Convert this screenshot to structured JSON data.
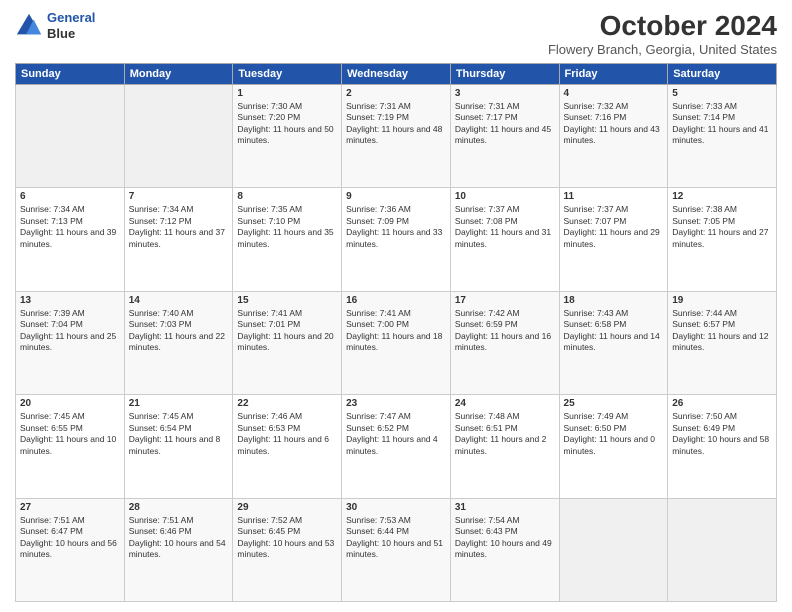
{
  "logo": {
    "line1": "General",
    "line2": "Blue"
  },
  "title": "October 2024",
  "location": "Flowery Branch, Georgia, United States",
  "days_of_week": [
    "Sunday",
    "Monday",
    "Tuesday",
    "Wednesday",
    "Thursday",
    "Friday",
    "Saturday"
  ],
  "weeks": [
    [
      {
        "day": "",
        "sunrise": "",
        "sunset": "",
        "daylight": ""
      },
      {
        "day": "",
        "sunrise": "",
        "sunset": "",
        "daylight": ""
      },
      {
        "day": "1",
        "sunrise": "Sunrise: 7:30 AM",
        "sunset": "Sunset: 7:20 PM",
        "daylight": "Daylight: 11 hours and 50 minutes."
      },
      {
        "day": "2",
        "sunrise": "Sunrise: 7:31 AM",
        "sunset": "Sunset: 7:19 PM",
        "daylight": "Daylight: 11 hours and 48 minutes."
      },
      {
        "day": "3",
        "sunrise": "Sunrise: 7:31 AM",
        "sunset": "Sunset: 7:17 PM",
        "daylight": "Daylight: 11 hours and 45 minutes."
      },
      {
        "day": "4",
        "sunrise": "Sunrise: 7:32 AM",
        "sunset": "Sunset: 7:16 PM",
        "daylight": "Daylight: 11 hours and 43 minutes."
      },
      {
        "day": "5",
        "sunrise": "Sunrise: 7:33 AM",
        "sunset": "Sunset: 7:14 PM",
        "daylight": "Daylight: 11 hours and 41 minutes."
      }
    ],
    [
      {
        "day": "6",
        "sunrise": "Sunrise: 7:34 AM",
        "sunset": "Sunset: 7:13 PM",
        "daylight": "Daylight: 11 hours and 39 minutes."
      },
      {
        "day": "7",
        "sunrise": "Sunrise: 7:34 AM",
        "sunset": "Sunset: 7:12 PM",
        "daylight": "Daylight: 11 hours and 37 minutes."
      },
      {
        "day": "8",
        "sunrise": "Sunrise: 7:35 AM",
        "sunset": "Sunset: 7:10 PM",
        "daylight": "Daylight: 11 hours and 35 minutes."
      },
      {
        "day": "9",
        "sunrise": "Sunrise: 7:36 AM",
        "sunset": "Sunset: 7:09 PM",
        "daylight": "Daylight: 11 hours and 33 minutes."
      },
      {
        "day": "10",
        "sunrise": "Sunrise: 7:37 AM",
        "sunset": "Sunset: 7:08 PM",
        "daylight": "Daylight: 11 hours and 31 minutes."
      },
      {
        "day": "11",
        "sunrise": "Sunrise: 7:37 AM",
        "sunset": "Sunset: 7:07 PM",
        "daylight": "Daylight: 11 hours and 29 minutes."
      },
      {
        "day": "12",
        "sunrise": "Sunrise: 7:38 AM",
        "sunset": "Sunset: 7:05 PM",
        "daylight": "Daylight: 11 hours and 27 minutes."
      }
    ],
    [
      {
        "day": "13",
        "sunrise": "Sunrise: 7:39 AM",
        "sunset": "Sunset: 7:04 PM",
        "daylight": "Daylight: 11 hours and 25 minutes."
      },
      {
        "day": "14",
        "sunrise": "Sunrise: 7:40 AM",
        "sunset": "Sunset: 7:03 PM",
        "daylight": "Daylight: 11 hours and 22 minutes."
      },
      {
        "day": "15",
        "sunrise": "Sunrise: 7:41 AM",
        "sunset": "Sunset: 7:01 PM",
        "daylight": "Daylight: 11 hours and 20 minutes."
      },
      {
        "day": "16",
        "sunrise": "Sunrise: 7:41 AM",
        "sunset": "Sunset: 7:00 PM",
        "daylight": "Daylight: 11 hours and 18 minutes."
      },
      {
        "day": "17",
        "sunrise": "Sunrise: 7:42 AM",
        "sunset": "Sunset: 6:59 PM",
        "daylight": "Daylight: 11 hours and 16 minutes."
      },
      {
        "day": "18",
        "sunrise": "Sunrise: 7:43 AM",
        "sunset": "Sunset: 6:58 PM",
        "daylight": "Daylight: 11 hours and 14 minutes."
      },
      {
        "day": "19",
        "sunrise": "Sunrise: 7:44 AM",
        "sunset": "Sunset: 6:57 PM",
        "daylight": "Daylight: 11 hours and 12 minutes."
      }
    ],
    [
      {
        "day": "20",
        "sunrise": "Sunrise: 7:45 AM",
        "sunset": "Sunset: 6:55 PM",
        "daylight": "Daylight: 11 hours and 10 minutes."
      },
      {
        "day": "21",
        "sunrise": "Sunrise: 7:45 AM",
        "sunset": "Sunset: 6:54 PM",
        "daylight": "Daylight: 11 hours and 8 minutes."
      },
      {
        "day": "22",
        "sunrise": "Sunrise: 7:46 AM",
        "sunset": "Sunset: 6:53 PM",
        "daylight": "Daylight: 11 hours and 6 minutes."
      },
      {
        "day": "23",
        "sunrise": "Sunrise: 7:47 AM",
        "sunset": "Sunset: 6:52 PM",
        "daylight": "Daylight: 11 hours and 4 minutes."
      },
      {
        "day": "24",
        "sunrise": "Sunrise: 7:48 AM",
        "sunset": "Sunset: 6:51 PM",
        "daylight": "Daylight: 11 hours and 2 minutes."
      },
      {
        "day": "25",
        "sunrise": "Sunrise: 7:49 AM",
        "sunset": "Sunset: 6:50 PM",
        "daylight": "Daylight: 11 hours and 0 minutes."
      },
      {
        "day": "26",
        "sunrise": "Sunrise: 7:50 AM",
        "sunset": "Sunset: 6:49 PM",
        "daylight": "Daylight: 10 hours and 58 minutes."
      }
    ],
    [
      {
        "day": "27",
        "sunrise": "Sunrise: 7:51 AM",
        "sunset": "Sunset: 6:47 PM",
        "daylight": "Daylight: 10 hours and 56 minutes."
      },
      {
        "day": "28",
        "sunrise": "Sunrise: 7:51 AM",
        "sunset": "Sunset: 6:46 PM",
        "daylight": "Daylight: 10 hours and 54 minutes."
      },
      {
        "day": "29",
        "sunrise": "Sunrise: 7:52 AM",
        "sunset": "Sunset: 6:45 PM",
        "daylight": "Daylight: 10 hours and 53 minutes."
      },
      {
        "day": "30",
        "sunrise": "Sunrise: 7:53 AM",
        "sunset": "Sunset: 6:44 PM",
        "daylight": "Daylight: 10 hours and 51 minutes."
      },
      {
        "day": "31",
        "sunrise": "Sunrise: 7:54 AM",
        "sunset": "Sunset: 6:43 PM",
        "daylight": "Daylight: 10 hours and 49 minutes."
      },
      {
        "day": "",
        "sunrise": "",
        "sunset": "",
        "daylight": ""
      },
      {
        "day": "",
        "sunrise": "",
        "sunset": "",
        "daylight": ""
      }
    ]
  ]
}
